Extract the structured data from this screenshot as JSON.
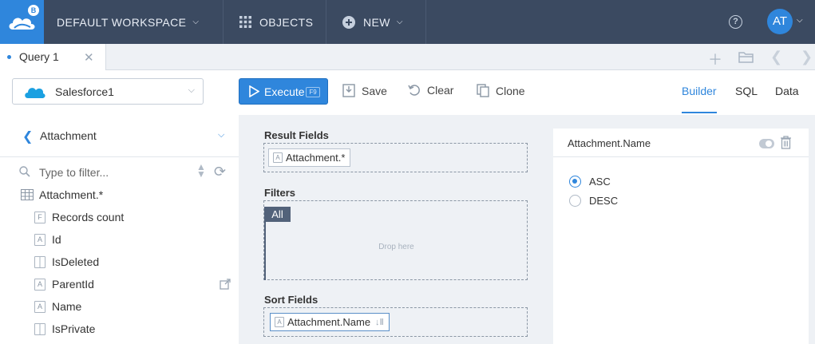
{
  "topbar": {
    "logo_badge": "B",
    "workspace": "DEFAULT WORKSPACE",
    "objects": "OBJECTS",
    "new": "NEW",
    "help": "?",
    "user_initials": "AT"
  },
  "tabs": [
    {
      "label": "Query 1"
    }
  ],
  "toolbar": {
    "connection": "Salesforce1",
    "execute": "Execute",
    "execute_key": "F9",
    "save": "Save",
    "clear": "Clear",
    "clone": "Clone",
    "modes": [
      "Builder",
      "SQL",
      "Data"
    ]
  },
  "sidebar": {
    "object": "Attachment",
    "filter_placeholder": "Type to filter...",
    "fields": [
      {
        "label": "Attachment.*",
        "icon": "table-icon"
      },
      {
        "label": "Records count",
        "icon": "F"
      },
      {
        "label": "Id",
        "icon": "A"
      },
      {
        "label": "IsDeleted",
        "icon": "boolean-icon"
      },
      {
        "label": "ParentId",
        "icon": "A"
      },
      {
        "label": "Name",
        "icon": "A"
      },
      {
        "label": "IsPrivate",
        "icon": "boolean-icon"
      }
    ]
  },
  "builder": {
    "result_fields_title": "Result Fields",
    "result_fields": [
      "Attachment.*"
    ],
    "filters_title": "Filters",
    "filter_group": "All",
    "drop_hint": "Drop here",
    "sort_fields_title": "Sort Fields",
    "sort_fields": [
      "Attachment.Name"
    ]
  },
  "properties": {
    "title": "Attachment.Name",
    "options": [
      "ASC",
      "DESC"
    ],
    "selected": "ASC"
  },
  "colors": {
    "topbar": "#3b4a61",
    "accent": "#2f86dc",
    "panel_bg": "#eef1f5"
  }
}
